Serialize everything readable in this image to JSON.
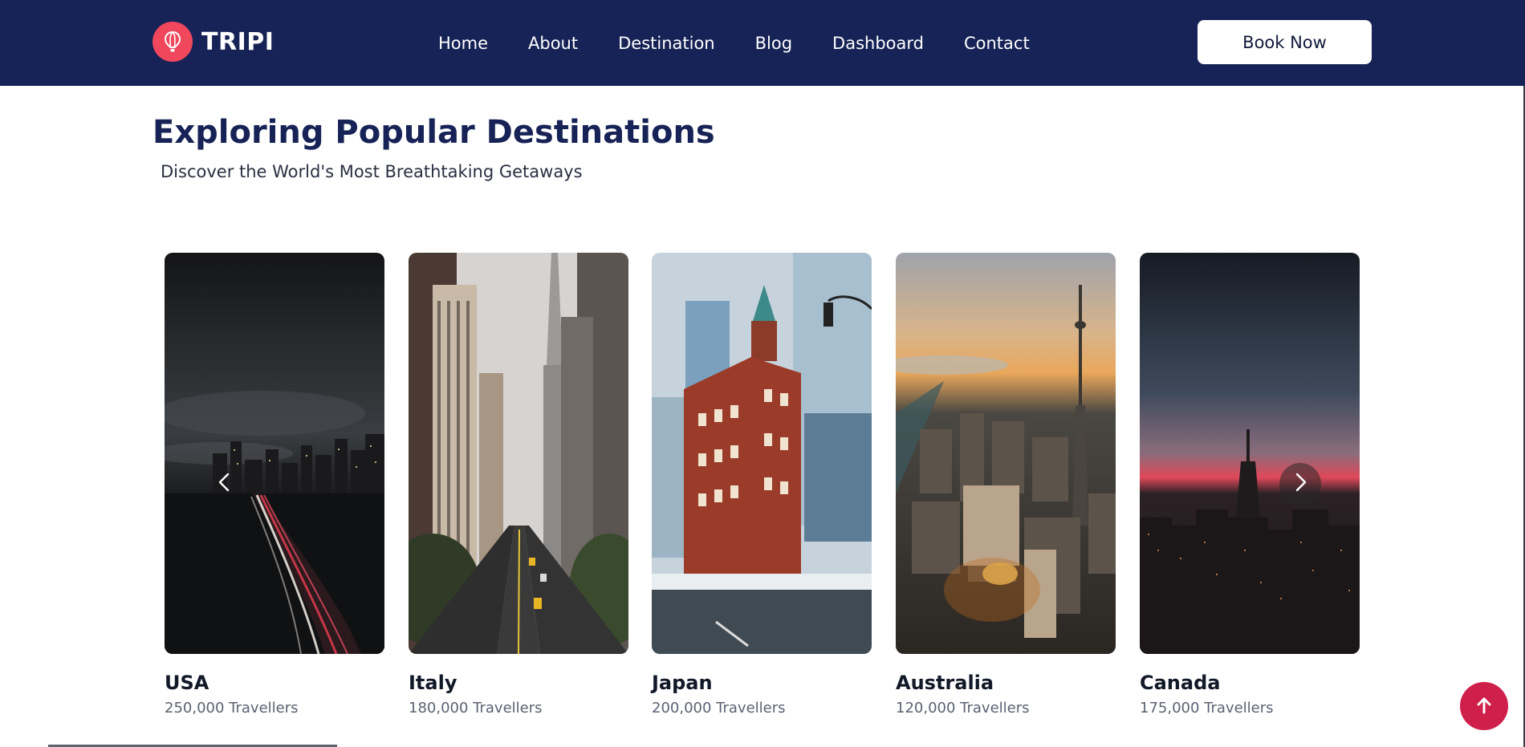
{
  "brand": {
    "name": "TRIPI",
    "icon": "hot-air-balloon-icon",
    "badge_color": "#f0475d"
  },
  "nav": {
    "items": [
      {
        "label": "Home"
      },
      {
        "label": "About"
      },
      {
        "label": "Destination"
      },
      {
        "label": "Blog"
      },
      {
        "label": "Dashboard"
      },
      {
        "label": "Contact"
      }
    ],
    "cta_label": "Book Now",
    "bar_color": "#172356"
  },
  "section": {
    "title": "Exploring Popular Destinations",
    "subtitle": "Discover the World's Most Breathtaking Getaways"
  },
  "destinations": [
    {
      "name": "USA",
      "travellers": "250,000 Travellers"
    },
    {
      "name": "Italy",
      "travellers": "180,000 Travellers"
    },
    {
      "name": "Japan",
      "travellers": "200,000 Travellers"
    },
    {
      "name": "Australia",
      "travellers": "120,000 Travellers"
    },
    {
      "name": "Canada",
      "travellers": "175,000 Travellers"
    }
  ],
  "carousel": {
    "prev_icon": "chevron-left-icon",
    "next_icon": "chevron-right-icon"
  },
  "scroll_top": {
    "icon": "arrow-up-icon",
    "color": "#cf1f4b"
  }
}
